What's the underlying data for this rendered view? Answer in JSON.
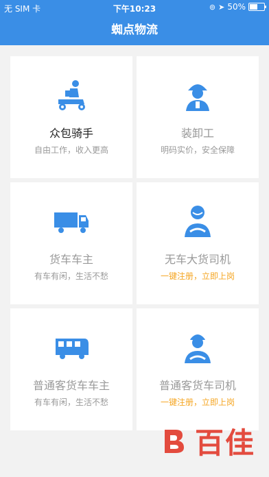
{
  "status": {
    "carrier": "无 SIM 卡",
    "time": "下午10:23",
    "battery": "50%"
  },
  "navbar": {
    "title": "蜘点物流"
  },
  "cards": [
    {
      "title": "众包骑手",
      "subtitle": "自由工作，收入更高",
      "icon": "scooter-rider-icon"
    },
    {
      "title": "装卸工",
      "subtitle": "明码实价，安全保障",
      "icon": "worker-helmet-icon"
    },
    {
      "title": "货车车主",
      "subtitle": "有车有闲，生活不愁",
      "icon": "truck-icon"
    },
    {
      "title": "无车大货司机",
      "subtitle": "一键注册，立即上岗",
      "icon": "driver-icon"
    },
    {
      "title": "普通客货车车主",
      "subtitle": "有车有闲，生活不愁",
      "icon": "van-icon"
    },
    {
      "title": "普通客货车司机",
      "subtitle": "一键注册，立即上岗",
      "icon": "driver-helmet-icon"
    }
  ],
  "colors": {
    "primary": "#3a8ee6",
    "highlight": "#f5a623",
    "watermark": "#e34b3e"
  },
  "watermark": {
    "text": "百佳"
  }
}
